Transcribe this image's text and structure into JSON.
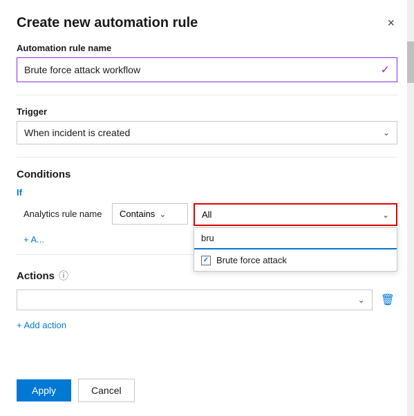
{
  "dialog": {
    "title": "Create new automation rule",
    "close_label": "×"
  },
  "automation_rule_name": {
    "label": "Automation rule name",
    "value": "Brute force attack workflow",
    "checkmark": "✓"
  },
  "trigger": {
    "label": "Trigger",
    "value": "When incident is created",
    "chevron": "⌄"
  },
  "conditions": {
    "label": "Conditions",
    "if_label": "If",
    "field_name": "Analytics rule name",
    "operator": "Contains",
    "operator_chevron": "⌄",
    "value_label": "All",
    "value_chevron": "⌄",
    "search_value": "bru",
    "dropdown_item": "Brute force attack",
    "add_and_label": "+ A..."
  },
  "actions": {
    "label": "Actions",
    "info_icon": "ⓘ",
    "action_placeholder": "",
    "action_chevron": "⌄",
    "delete_icon": "🗑",
    "add_action_label": "+ Add action"
  },
  "footer": {
    "apply_label": "Apply",
    "cancel_label": "Cancel"
  }
}
